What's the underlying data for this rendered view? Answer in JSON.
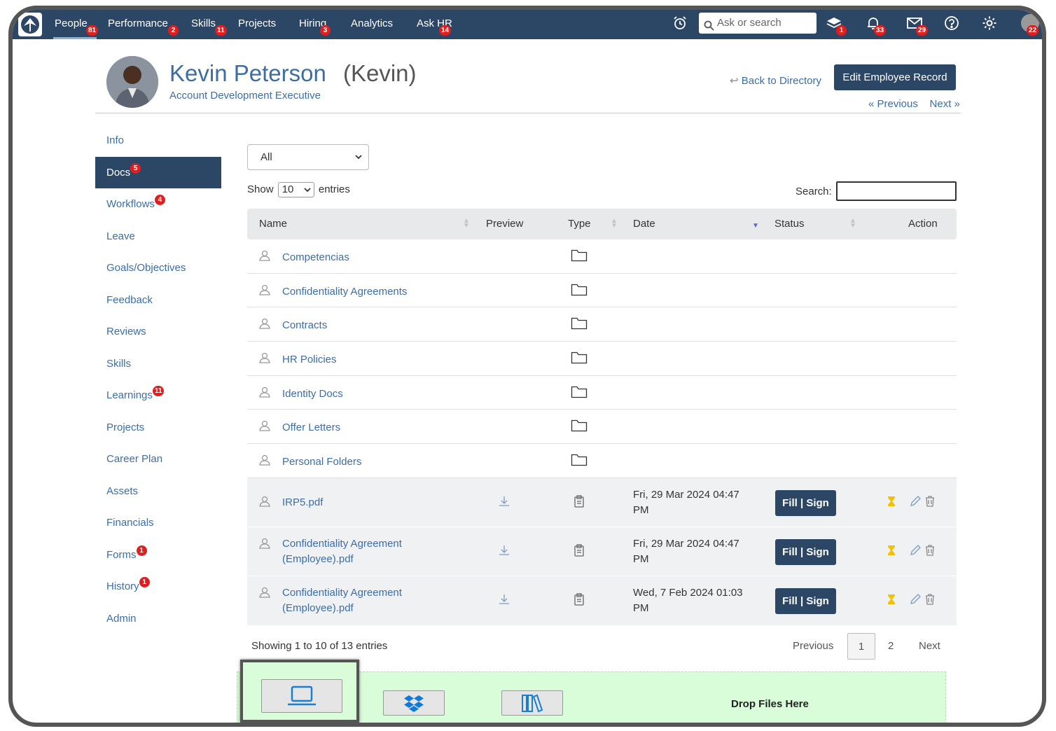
{
  "nav": {
    "items": [
      {
        "label": "People",
        "badge": "81"
      },
      {
        "label": "Performance",
        "badge": "2"
      },
      {
        "label": "Skills",
        "badge": "11"
      },
      {
        "label": "Projects",
        "badge": ""
      },
      {
        "label": "Hiring",
        "badge": "3"
      },
      {
        "label": "Analytics",
        "badge": ""
      },
      {
        "label": "Ask HR",
        "badge": "14"
      }
    ],
    "search_placeholder": "Ask or search",
    "badges": {
      "layers": "1",
      "bell": "33",
      "mail": "29",
      "avatar": "22"
    }
  },
  "employee": {
    "name": "Kevin Peterson",
    "nickname": "(Kevin)",
    "title": "Account Development Executive"
  },
  "header": {
    "back_label": "Back to Directory",
    "edit_label": "Edit Employee Record",
    "previous_label": "« Previous",
    "next_label": "Next »"
  },
  "sidebar": {
    "items": [
      {
        "label": "Info",
        "badge": ""
      },
      {
        "label": "Docs",
        "badge": "5"
      },
      {
        "label": "Workflows",
        "badge": "4"
      },
      {
        "label": "Leave",
        "badge": ""
      },
      {
        "label": "Goals/Objectives",
        "badge": ""
      },
      {
        "label": "Feedback",
        "badge": ""
      },
      {
        "label": "Reviews",
        "badge": ""
      },
      {
        "label": "Skills",
        "badge": ""
      },
      {
        "label": "Learnings",
        "badge": "11"
      },
      {
        "label": "Projects",
        "badge": ""
      },
      {
        "label": "Career Plan",
        "badge": ""
      },
      {
        "label": "Assets",
        "badge": ""
      },
      {
        "label": "Financials",
        "badge": ""
      },
      {
        "label": "Forms",
        "badge": "1"
      },
      {
        "label": "History",
        "badge": "1"
      },
      {
        "label": "Admin",
        "badge": ""
      }
    ]
  },
  "filter": {
    "value": "All"
  },
  "entries": {
    "show_label": "Show",
    "value": "10",
    "entries_label": "entries",
    "search_label": "Search:"
  },
  "table": {
    "headers": {
      "name": "Name",
      "preview": "Preview",
      "type": "Type",
      "date": "Date",
      "status": "Status",
      "action": "Action"
    },
    "folders": [
      "Competencias",
      "Confidentiality Agreements",
      "Contracts",
      "HR Policies",
      "Identity Docs",
      "Offer Letters",
      "Personal Folders"
    ],
    "files": [
      {
        "name": "IRP5.pdf",
        "date": "Fri, 29 Mar 2024 04:47 PM",
        "status": "Fill | Sign"
      },
      {
        "name": "Confidentiality Agreement (Employee).pdf",
        "date": "Fri, 29 Mar 2024 04:47 PM",
        "status": "Fill | Sign"
      },
      {
        "name": "Confidentiality Agreement (Employee).pdf",
        "date": "Wed, 7 Feb 2024 01:03 PM",
        "status": "Fill | Sign"
      }
    ]
  },
  "footer": {
    "showing": "Showing 1 to 10 of 13 entries",
    "previous": "Previous",
    "page1": "1",
    "page2": "2",
    "next": "Next"
  },
  "dropzone": {
    "label": "Drop Files Here"
  },
  "colors": {
    "navy": "#2c4666",
    "link": "#3c6da5",
    "badge": "#e21d1d",
    "dropzone": "#d9fcd9"
  }
}
